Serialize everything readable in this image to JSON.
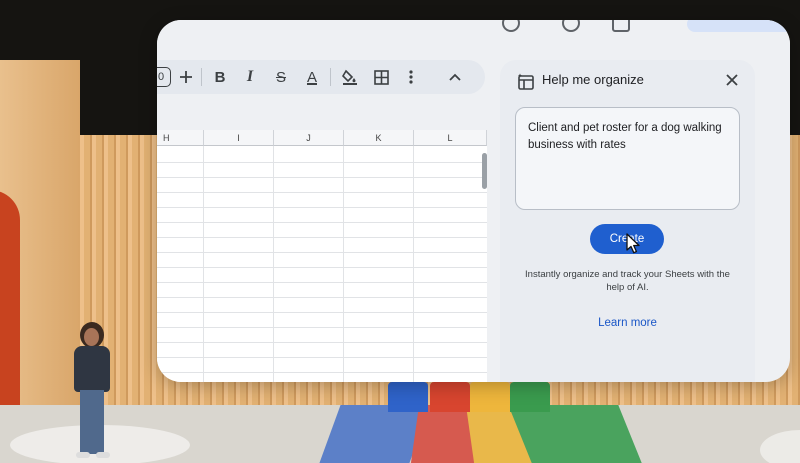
{
  "toolbar": {
    "left_partial_label": "0",
    "add_icon": "plus-icon",
    "bold_label": "B",
    "italic_label": "I",
    "strike_label": "S",
    "text_color_label": "A",
    "fill_icon": "paint-bucket-icon",
    "borders_icon": "borders-icon",
    "more_icon": "more-vert-icon",
    "collapse_icon": "chevron-up-icon"
  },
  "sheet": {
    "columns": [
      "H",
      "I",
      "J",
      "K",
      "L"
    ],
    "visible_rows": 15
  },
  "panel": {
    "title": "Help me organize",
    "prompt_text": "Client and pet roster for a dog walking business with rates",
    "create_label": "Create",
    "info_text": "Instantly organize and track your Sheets with the help of AI.",
    "learn_more_label": "Learn more"
  },
  "colors": {
    "accent": "#1f5fcf",
    "link": "#1a56c7",
    "panel_bg": "#e9ecf1"
  }
}
